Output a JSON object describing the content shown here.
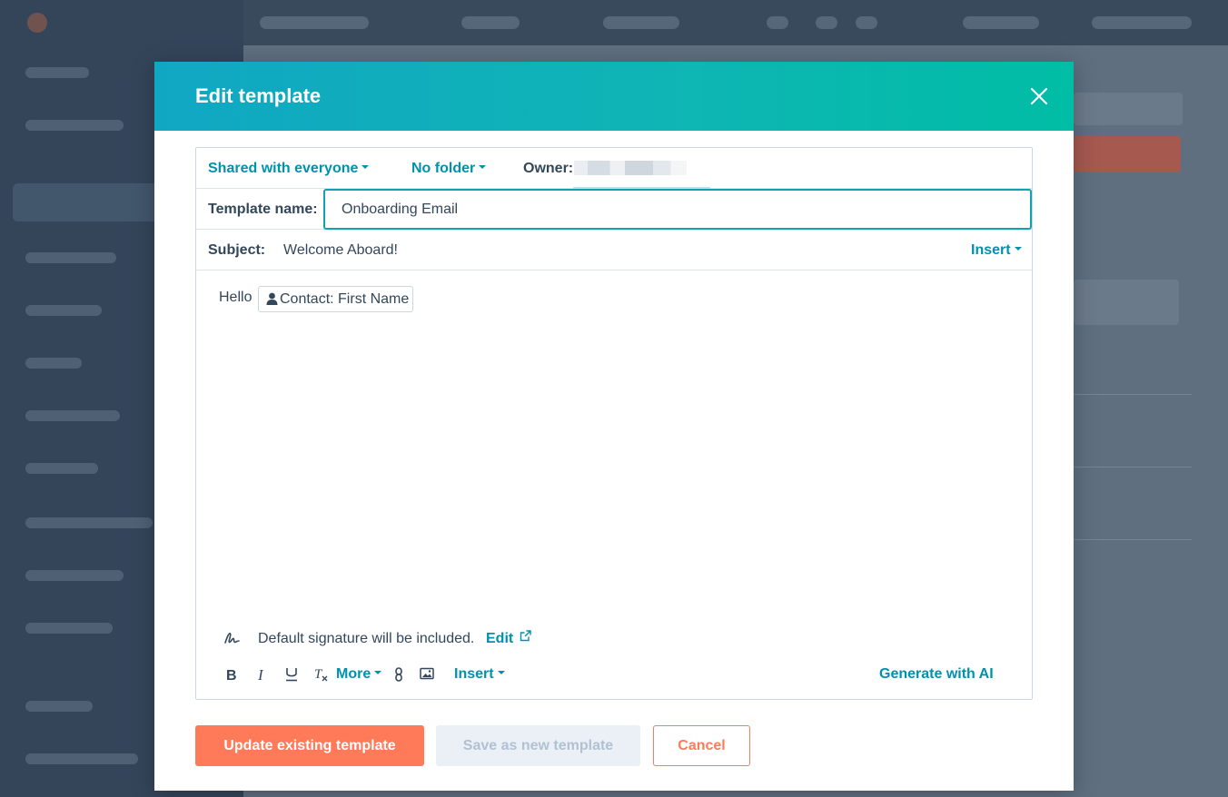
{
  "modal": {
    "title": "Edit template"
  },
  "meta_row": {
    "sharing": "Shared with everyone",
    "folder": "No folder",
    "owner_label": "Owner:"
  },
  "template_name": {
    "label": "Template name:",
    "value": "Onboarding Email"
  },
  "subject": {
    "label": "Subject:",
    "value": "Welcome Aboard!",
    "insert_label": "Insert"
  },
  "body": {
    "greeting": "Hello",
    "token_label": "Contact: First Name"
  },
  "signature": {
    "text": "Default signature will be included.",
    "edit_label": "Edit"
  },
  "toolbar": {
    "more_label": "More",
    "insert_label": "Insert",
    "generate_label": "Generate with AI"
  },
  "footer": {
    "update_label": "Update existing template",
    "save_new_label": "Save as new template",
    "cancel_label": "Cancel"
  },
  "colors": {
    "accent": "#0091ae",
    "primary_button": "#ff7a59",
    "header_gradient_start": "#10a7c3",
    "header_gradient_end": "#00bda5"
  },
  "icons": [
    "close-icon",
    "person-icon",
    "signature-icon",
    "external-link-icon",
    "bold-icon",
    "italic-icon",
    "underline-icon",
    "clear-format-icon",
    "link-icon",
    "image-icon"
  ]
}
